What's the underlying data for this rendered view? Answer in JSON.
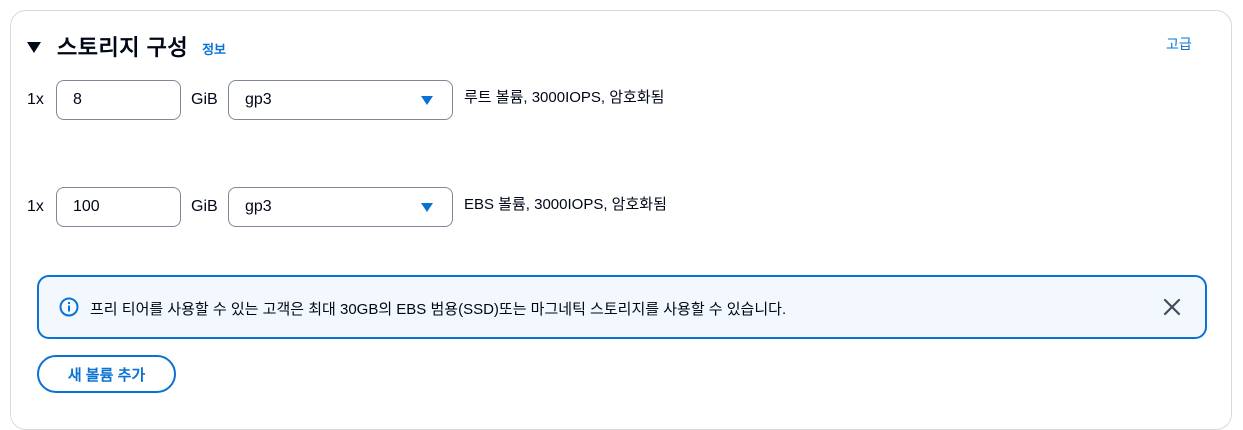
{
  "section": {
    "title": "스토리지 구성",
    "info_label": "정보",
    "advanced_label": "고급",
    "caret_icon": "caret-down-icon"
  },
  "volumes": [
    {
      "count": "1x",
      "size": "8",
      "unit": "GiB",
      "type": "gp3",
      "description": "루트 볼륨,  3000IOPS,  암호화됨"
    },
    {
      "count": "1x",
      "size": "100",
      "unit": "GiB",
      "type": "gp3",
      "description": "EBS 볼륨,  3000IOPS,  암호화됨"
    }
  ],
  "alert": {
    "icon": "info-circle-icon",
    "text": "프리 티어를 사용할 수 있는 고객은 최대 30GB의 EBS 범용(SSD)또는 마그네틱 스토리지를 사용할 수 있습니다.",
    "close_icon": "close-icon"
  },
  "add_volume_button": "새 볼륨 추가",
  "colors": {
    "accent": "#0972d3",
    "alert_bg": "#f2f8fd",
    "text": "#000716",
    "border": "#7d8998"
  }
}
